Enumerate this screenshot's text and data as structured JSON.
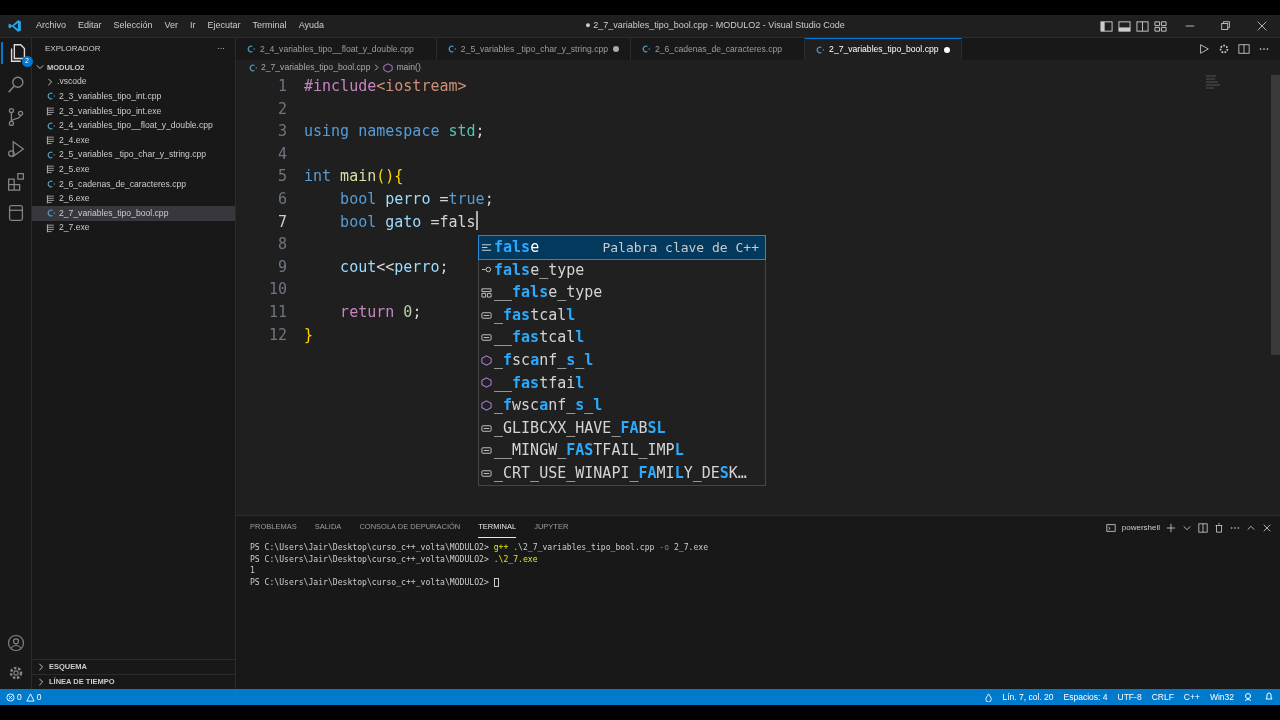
{
  "window": {
    "title": "● 2_7_variables_tipo_bool.cpp - MODULO2 - Visual Studio Code"
  },
  "menu": [
    "Archivo",
    "Editar",
    "Selección",
    "Ver",
    "Ir",
    "Ejecutar",
    "Terminal",
    "Ayuda"
  ],
  "activity_bar": {
    "explorer_badge": "2"
  },
  "sidebar": {
    "title": "EXPLORADOR",
    "more": "···",
    "tree": [
      {
        "label": "MODULO2",
        "kind": "root",
        "expanded": true,
        "selected": false,
        "children": [
          {
            "label": ".vscode",
            "kind": "folder",
            "expanded": false,
            "selected": false
          },
          {
            "label": "2_3_variables_tipo_int.cpp",
            "kind": "cpp",
            "selected": false
          },
          {
            "label": "2_3_variables_tipo_int.exe",
            "kind": "exe",
            "selected": false
          },
          {
            "label": "2_4_variables_tipo__float_y_double.cpp",
            "kind": "cpp",
            "selected": false
          },
          {
            "label": "2_4.exe",
            "kind": "exe",
            "selected": false
          },
          {
            "label": "2_5_variables _tipo_char_y_string.cpp",
            "kind": "cpp",
            "selected": false
          },
          {
            "label": "2_5.exe",
            "kind": "exe",
            "selected": false
          },
          {
            "label": "2_6_cadenas_de_caracteres.cpp",
            "kind": "cpp",
            "selected": false
          },
          {
            "label": "2_6.exe",
            "kind": "exe",
            "selected": false
          },
          {
            "label": "2_7_variables_tipo_bool.cpp",
            "kind": "cpp",
            "selected": true
          },
          {
            "label": "2_7.exe",
            "kind": "exe",
            "selected": false
          }
        ]
      }
    ],
    "sections": [
      {
        "label": "ESQUEMA",
        "expanded": false
      },
      {
        "label": "LÍNEA DE TIEMPO",
        "expanded": false
      }
    ]
  },
  "tabs": [
    {
      "label": "2_4_variables_tipo__float_y_double.cpp",
      "modified": false,
      "selected": false
    },
    {
      "label": "2_5_variables _tipo_char_y_string.cpp",
      "modified": true,
      "selected": false
    },
    {
      "label": "2_6_cadenas_de_caracteres.cpp",
      "modified": false,
      "selected": false
    },
    {
      "label": "2_7_variables_tipo_bool.cpp",
      "modified": true,
      "selected": true
    }
  ],
  "breadcrumb": {
    "file": "2_7_variables_tipo_bool.cpp",
    "symbol": "main()"
  },
  "code": [
    {
      "number": "1",
      "tokens": [
        {
          "text": "#include",
          "kind": "control"
        },
        {
          "text": "<iostream>",
          "kind": "string"
        }
      ]
    },
    {
      "number": "2"
    },
    {
      "number": "3",
      "tokens": [
        {
          "text": "using namespace",
          "kind": "keyword"
        },
        {
          "text": " std",
          "kind": "namespace"
        },
        {
          "text": ";",
          "kind": "plain"
        }
      ]
    },
    {
      "number": "4"
    },
    {
      "number": "5",
      "tokens": [
        {
          "text": "int",
          "kind": "keyword"
        },
        {
          "text": " main",
          "kind": "function"
        },
        {
          "text": "(){",
          "kind": "bracket"
        }
      ]
    },
    {
      "number": "6",
      "tokens": [
        {
          "text": "    bool",
          "kind": "keyword"
        },
        {
          "text": " perro ",
          "kind": "variable"
        },
        {
          "text": "=",
          "kind": "plain"
        },
        {
          "text": "true",
          "kind": "keyword"
        },
        {
          "text": ";",
          "kind": "plain"
        }
      ]
    },
    {
      "number": "7",
      "cursor": true,
      "tokens": [
        {
          "text": "    bool",
          "kind": "keyword"
        },
        {
          "text": " gato ",
          "kind": "variable"
        },
        {
          "text": "=fals",
          "kind": "plain"
        }
      ]
    },
    {
      "number": "8"
    },
    {
      "number": "9",
      "tokens": [
        {
          "text": "    cout",
          "kind": "variable"
        },
        {
          "text": "<<",
          "kind": "plain"
        },
        {
          "text": "perro",
          "kind": "variable"
        },
        {
          "text": ";",
          "kind": "plain"
        }
      ]
    },
    {
      "number": "10"
    },
    {
      "number": "11",
      "tokens": [
        {
          "text": "    return",
          "kind": "control"
        },
        {
          "text": " 0",
          "kind": "number"
        },
        {
          "text": ";",
          "kind": "plain"
        }
      ]
    },
    {
      "number": "12",
      "tokens": [
        {
          "text": "}",
          "kind": "bracket"
        }
      ]
    }
  ],
  "suggestions": [
    {
      "kind": "keyword",
      "selected": true,
      "detail": "Palabra clave de C++",
      "parts": [
        {
          "text": "fals",
          "match": true
        },
        {
          "text": "e",
          "match": false
        }
      ]
    },
    {
      "kind": "field",
      "selected": false,
      "parts": [
        {
          "text": "fals",
          "match": true
        },
        {
          "text": "e_type",
          "match": false
        }
      ]
    },
    {
      "kind": "struct",
      "selected": false,
      "parts": [
        {
          "text": "__",
          "match": false
        },
        {
          "text": "fals",
          "match": true
        },
        {
          "text": "e_type",
          "match": false
        }
      ]
    },
    {
      "kind": "macro",
      "selected": false,
      "parts": [
        {
          "text": "_",
          "match": false
        },
        {
          "text": "fas",
          "match": true
        },
        {
          "text": "tcal",
          "match": false
        },
        {
          "text": "l",
          "match": true
        }
      ]
    },
    {
      "kind": "macro",
      "selected": false,
      "parts": [
        {
          "text": "__",
          "match": false
        },
        {
          "text": "fas",
          "match": true
        },
        {
          "text": "tcal",
          "match": false
        },
        {
          "text": "l",
          "match": true
        }
      ]
    },
    {
      "kind": "method",
      "selected": false,
      "parts": [
        {
          "text": "_",
          "match": false
        },
        {
          "text": "f",
          "match": true
        },
        {
          "text": "sc",
          "match": false
        },
        {
          "text": "a",
          "match": true
        },
        {
          "text": "nf_",
          "match": false
        },
        {
          "text": "s",
          "match": true
        },
        {
          "text": "_",
          "match": false
        },
        {
          "text": "l",
          "match": true
        }
      ]
    },
    {
      "kind": "method",
      "selected": false,
      "parts": [
        {
          "text": "__",
          "match": false
        },
        {
          "text": "fas",
          "match": true
        },
        {
          "text": "tfai",
          "match": false
        },
        {
          "text": "l",
          "match": true
        }
      ]
    },
    {
      "kind": "method",
      "selected": false,
      "parts": [
        {
          "text": "_",
          "match": false
        },
        {
          "text": "f",
          "match": true
        },
        {
          "text": "wsc",
          "match": false
        },
        {
          "text": "a",
          "match": true
        },
        {
          "text": "nf_",
          "match": false
        },
        {
          "text": "s",
          "match": true
        },
        {
          "text": "_",
          "match": false
        },
        {
          "text": "l",
          "match": true
        }
      ]
    },
    {
      "kind": "macro",
      "selected": false,
      "parts": [
        {
          "text": "_GLIBCXX_HAVE_",
          "match": false
        },
        {
          "text": "FA",
          "match": true
        },
        {
          "text": "B",
          "match": false
        },
        {
          "text": "SL",
          "match": true
        }
      ]
    },
    {
      "kind": "macro",
      "selected": false,
      "parts": [
        {
          "text": "__MINGW_",
          "match": false
        },
        {
          "text": "FAS",
          "match": true
        },
        {
          "text": "TFAIL_IMP",
          "match": false
        },
        {
          "text": "L",
          "match": true
        }
      ]
    },
    {
      "kind": "macro",
      "selected": false,
      "parts": [
        {
          "text": "_CRT_USE_WINAPI_",
          "match": false
        },
        {
          "text": "FA",
          "match": true
        },
        {
          "text": "MI",
          "match": false
        },
        {
          "text": "L",
          "match": true
        },
        {
          "text": "Y_DE",
          "match": false
        },
        {
          "text": "S",
          "match": true
        },
        {
          "text": "K…",
          "match": false
        }
      ]
    }
  ],
  "panel": {
    "tabs": [
      {
        "label": "PROBLEMAS",
        "selected": false
      },
      {
        "label": "SALIDA",
        "selected": false
      },
      {
        "label": "CONSOLA DE DEPURACIÓN",
        "selected": false
      },
      {
        "label": "TERMINAL",
        "selected": true
      },
      {
        "label": "JUPYTER",
        "selected": false
      }
    ],
    "shell": "powershell",
    "terminal": [
      {
        "parts": [
          {
            "text": "PS C:\\Users\\Jair\\Desktop\\curso_c++_volta\\MODULO2> ",
            "kind": "prompt"
          },
          {
            "text": "g++",
            "kind": "command"
          },
          {
            "text": " .\\2_7_variables_tipo_bool.cpp ",
            "kind": "arg"
          },
          {
            "text": "-o",
            "kind": "flag"
          },
          {
            "text": " 2_7.exe",
            "kind": "arg"
          }
        ]
      },
      {
        "parts": [
          {
            "text": "PS C:\\Users\\Jair\\Desktop\\curso_c++_volta\\MODULO2> ",
            "kind": "prompt"
          },
          {
            "text": ".\\2_7.exe",
            "kind": "command"
          }
        ]
      },
      {
        "parts": [
          {
            "text": "1",
            "kind": "prompt"
          }
        ]
      },
      {
        "parts": [
          {
            "text": "PS C:\\Users\\Jair\\Desktop\\curso_c++_volta\\MODULO2> ",
            "kind": "prompt"
          }
        ],
        "cursor": true
      }
    ]
  },
  "status_bar": {
    "errors": "0",
    "warnings": "0",
    "items": [
      "Lín. 7, col. 20",
      "Espacios: 4",
      "UTF-8",
      "CRLF",
      "C++",
      "Win32"
    ]
  }
}
